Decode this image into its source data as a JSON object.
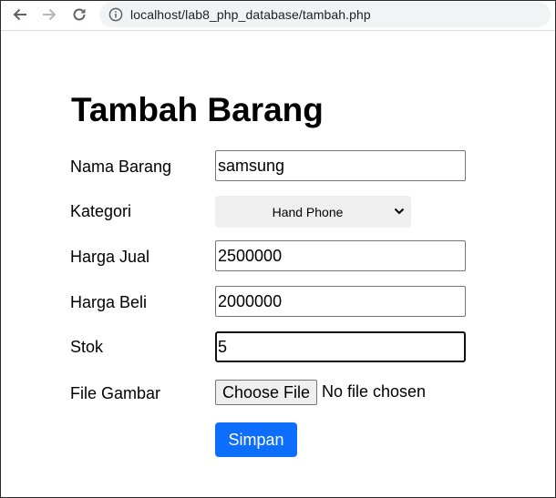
{
  "browser": {
    "url": "localhost/lab8_php_database/tambah.php"
  },
  "page": {
    "title": "Tambah Barang"
  },
  "form": {
    "nama_barang": {
      "label": "Nama Barang",
      "value": "samsung"
    },
    "kategori": {
      "label": "Kategori",
      "selected": "Hand Phone"
    },
    "harga_jual": {
      "label": "Harga Jual",
      "value": "2500000"
    },
    "harga_beli": {
      "label": "Harga Beli",
      "value": "2000000"
    },
    "stok": {
      "label": "Stok",
      "value": "5"
    },
    "file_gambar": {
      "label": "File Gambar",
      "button_label": "Choose File",
      "status": "No file chosen"
    },
    "submit_label": "Simpan"
  },
  "colors": {
    "submit_background": "#0d6efd",
    "select_background": "#efefef",
    "omnibox_background": "#f1f3f4"
  },
  "icons": {
    "back": "back-arrow-icon",
    "forward": "forward-arrow-icon",
    "reload": "reload-icon",
    "site_info": "info-circle-icon",
    "select_caret": "chevron-down-icon"
  }
}
